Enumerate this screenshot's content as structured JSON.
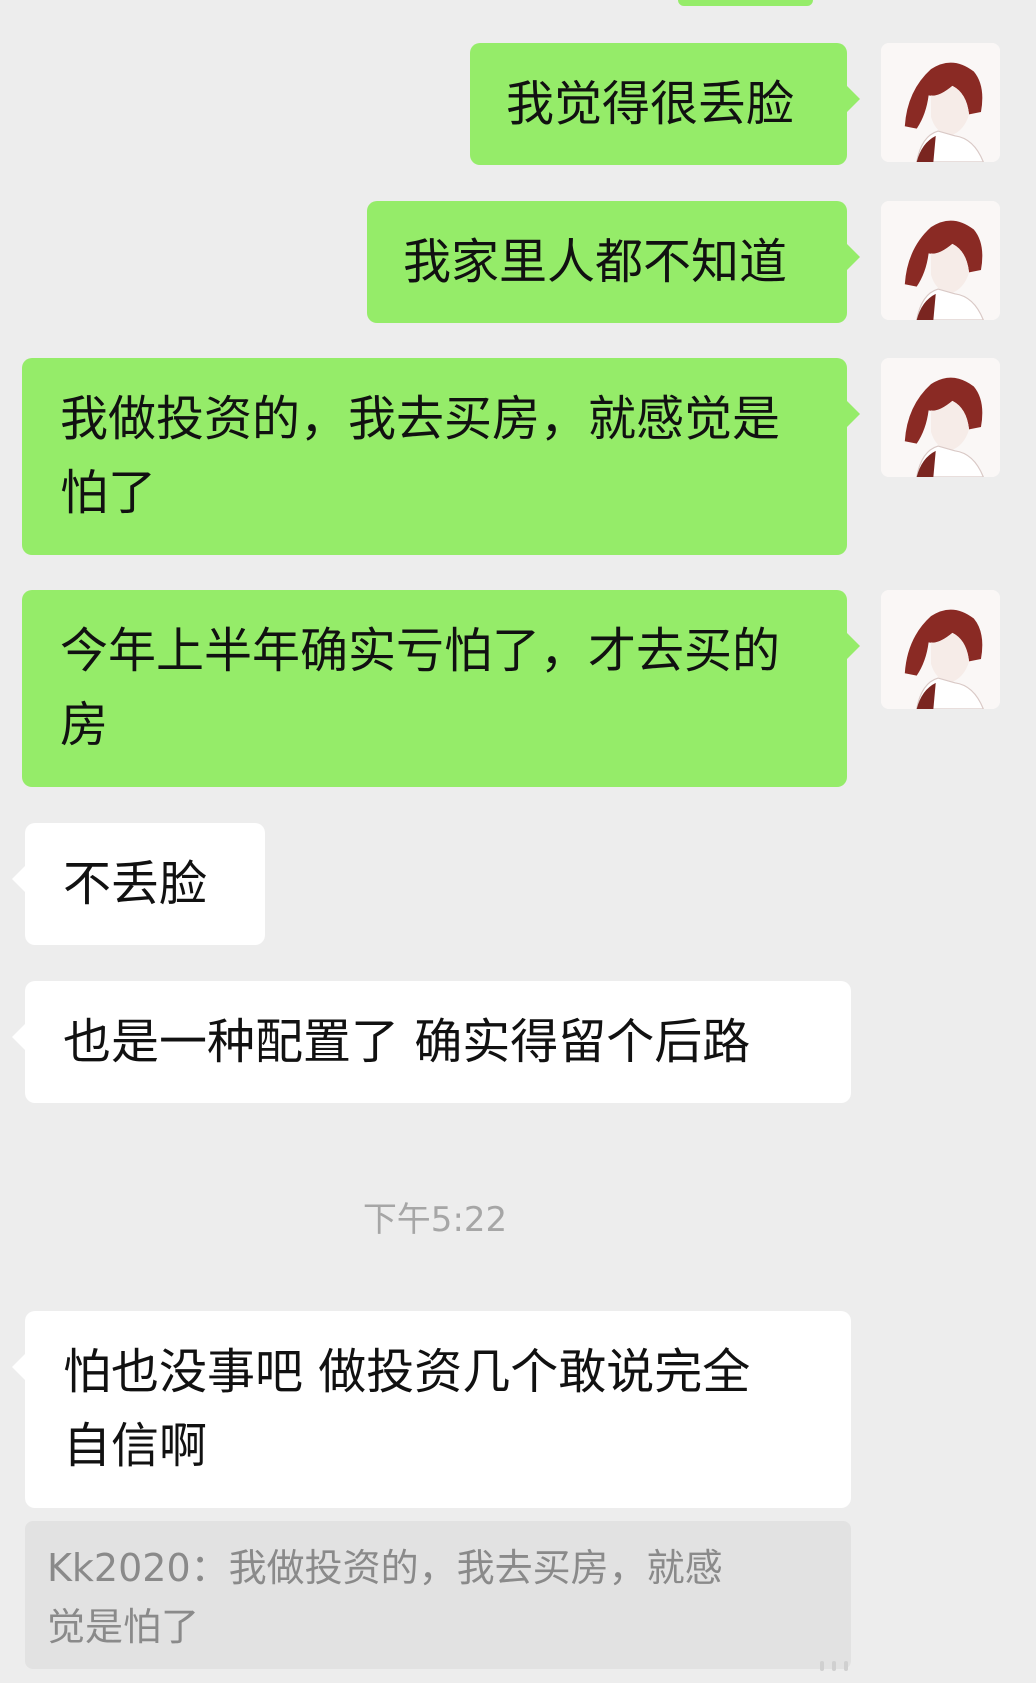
{
  "messages": [
    {
      "sender": "me",
      "text": "我觉得很丢脸"
    },
    {
      "sender": "me",
      "text": "我家里人都不知道"
    },
    {
      "sender": "me",
      "text": "我做投资的，我去买房，就感觉是\n怕了"
    },
    {
      "sender": "me",
      "text": "今年上半年确实亏怕了，才去买的\n房"
    },
    {
      "sender": "them",
      "text": "不丢脸"
    },
    {
      "sender": "them",
      "text": "也是一种配置了 确实得留个后路"
    },
    {
      "sender": "them",
      "text": "怕也没事吧 做投资几个敢说完全\n自信啊"
    }
  ],
  "timestamp": "下午5:22",
  "quote": {
    "text": "Kk2020：我做投资的，我去买房，就感\n觉是怕了"
  },
  "colors": {
    "self_bubble": "#95ec69",
    "other_bubble": "#ffffff",
    "background": "#ededed"
  },
  "icons": {
    "avatar": "anime-avatar-icon"
  }
}
